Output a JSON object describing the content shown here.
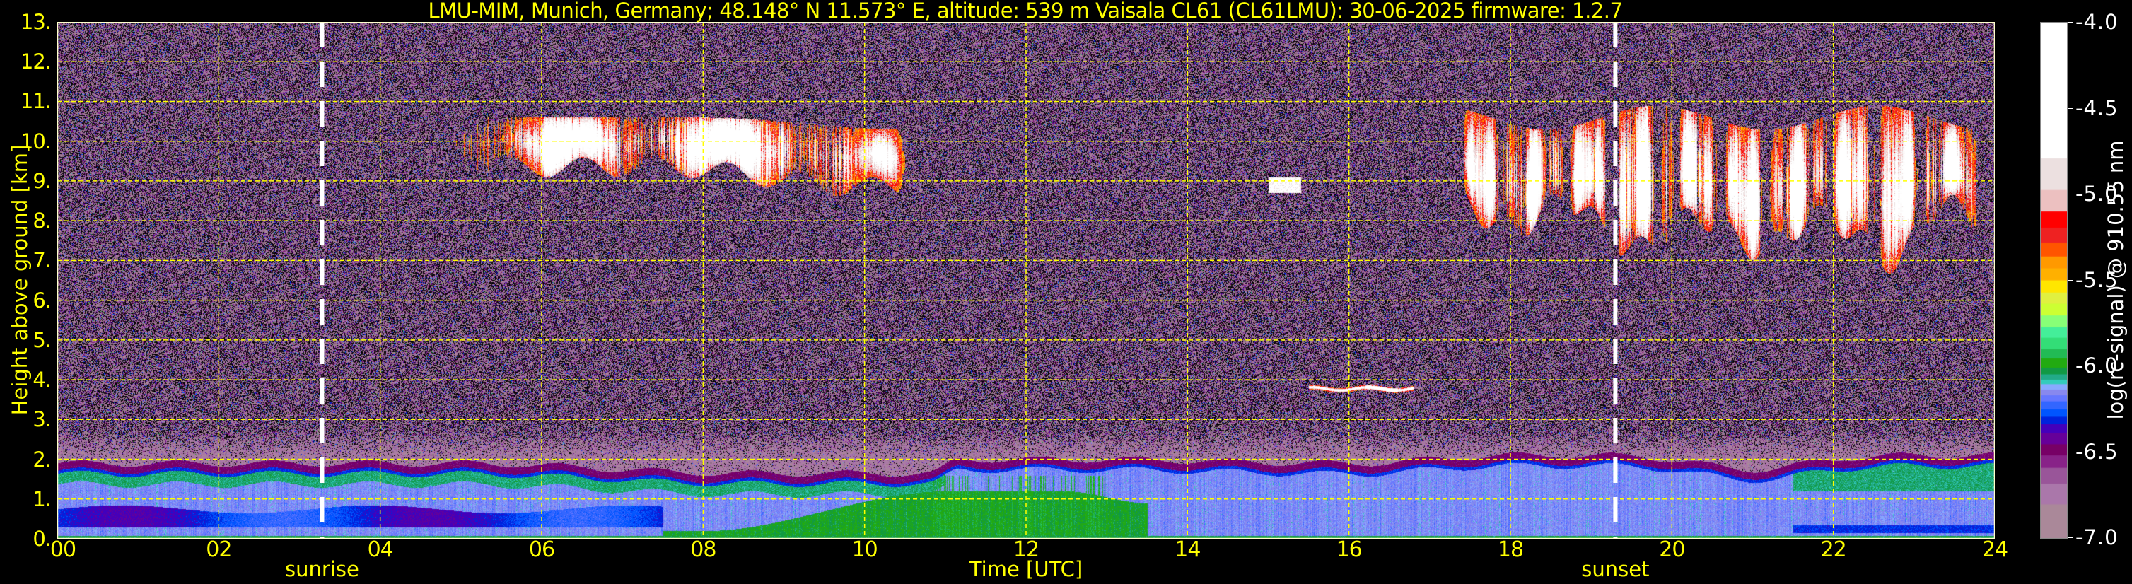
{
  "title": "LMU-MIM, Munich, Germany; 48.148° N 11.573° E, altitude: 539 m    Vaisala CL61 (CL61LMU): 30-06-2025    firmware: 1.2.7",
  "chart_data": {
    "type": "heatmap",
    "xlabel": "Time [UTC]",
    "ylabel": "Height above ground [km]",
    "xlim": [
      0,
      24
    ],
    "ylim": [
      0,
      13
    ],
    "x_ticks": [
      0,
      2,
      4,
      6,
      8,
      10,
      12,
      14,
      16,
      18,
      20,
      22,
      24
    ],
    "x_tick_labels": [
      "00",
      "02",
      "04",
      "06",
      "08",
      "10",
      "12",
      "14",
      "16",
      "18",
      "20",
      "22",
      "24"
    ],
    "y_ticks": [
      0,
      1,
      2,
      3,
      4,
      5,
      6,
      7,
      8,
      9,
      10,
      11,
      12,
      13
    ],
    "y_tick_labels": [
      "0.",
      "1.",
      "2.",
      "3.",
      "4.",
      "5.",
      "6.",
      "7.",
      "8.",
      "9.",
      "10.",
      "11.",
      "12.",
      "13."
    ],
    "grid": true,
    "grid_color": "#ffff00",
    "colorbar": {
      "label": "log(rc-signal) @ 910.55 nm",
      "clim": [
        -7.0,
        -4.0
      ],
      "ticks": [
        -4.0,
        -4.5,
        -5.0,
        -5.5,
        -6.0,
        -6.5,
        -7.0
      ],
      "tick_labels": [
        "-4.0",
        "-4.5",
        "-5.0",
        "-5.5",
        "-6.0",
        "-6.5",
        "-7.0"
      ],
      "levels": [
        -7.0,
        -6.8,
        -6.68,
        -6.587,
        -6.515,
        -6.45,
        -6.385,
        -6.333,
        -6.29,
        -6.247,
        -6.2,
        -6.165,
        -6.132,
        -6.1,
        -6.074,
        -6.043,
        -6.004,
        -5.95,
        -5.896,
        -5.83,
        -5.768,
        -5.7,
        -5.632,
        -5.567,
        -5.496,
        -5.426,
        -5.357,
        -5.277,
        -5.19,
        -5.095,
        -4.97,
        -4.786,
        -4.0
      ],
      "colors": [
        "#aa8899",
        "#aa77aa",
        "#995599",
        "#882288",
        "#770066",
        "#660099",
        "#4400bb",
        "#0022dd",
        "#0055ff",
        "#3366ff",
        "#6677ff",
        "#8888ee",
        "#88aaff",
        "#33ccbb",
        "#22aa88",
        "#119944",
        "#22aa11",
        "#22bb55",
        "#33dd77",
        "#44ee99",
        "#88ff77",
        "#ccff33",
        "#e0f040",
        "#ffe600",
        "#ffb000",
        "#ff9900",
        "#ff5500",
        "#ee2222",
        "#ff0000",
        "#ecc0c0",
        "#ece0e0",
        "#ffffff"
      ]
    },
    "annotations": [
      {
        "label": "sunrise",
        "time": 3.28
      },
      {
        "label": "sunset",
        "time": 19.3
      }
    ],
    "features": [
      {
        "kind": "cirrus",
        "time": [
          4.6,
          10.5
        ],
        "height": [
          8.8,
          10.7
        ]
      },
      {
        "kind": "cloud-fragment",
        "time": [
          15.0,
          15.4
        ],
        "height": [
          8.7,
          9.1
        ]
      },
      {
        "kind": "altocumulus",
        "time": [
          15.5,
          16.8
        ],
        "height": [
          3.7,
          3.85
        ]
      },
      {
        "kind": "cirrus",
        "time": [
          17.2,
          23.9
        ],
        "height": [
          7.6,
          10.9
        ]
      },
      {
        "kind": "boundary-layer-top",
        "time": [
          0,
          24
        ],
        "height": [
          1.3,
          1.9
        ]
      }
    ]
  }
}
